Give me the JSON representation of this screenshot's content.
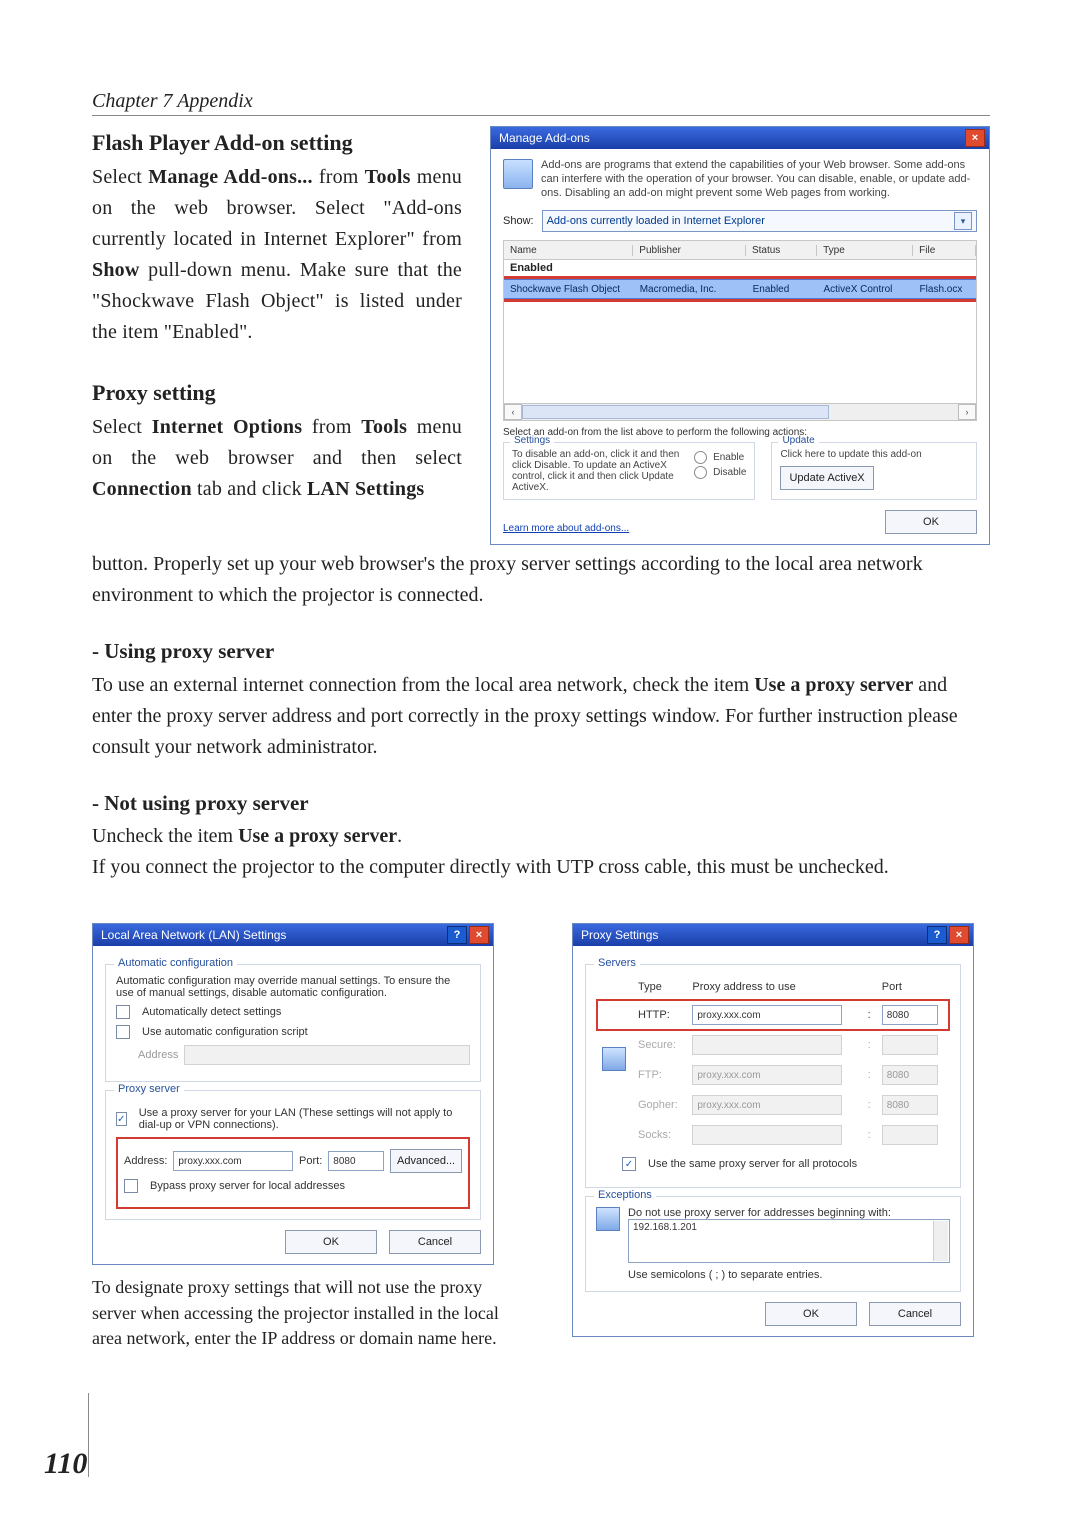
{
  "chapter": "Chapter 7 Appendix",
  "flash": {
    "heading": "Flash Player Add-on setting",
    "body_pre": "Select ",
    "b1": "Manage Add-ons...",
    "mid1": " from ",
    "b2": "Tools",
    "rest1": " menu on the web browser. Select \"Add-ons currently located in Internet Explorer\" from ",
    "b3": "Show",
    "rest2": " pull-down menu. Make sure that the \"Shockwave Flash Object\" is listed under the item \"Enabled\"."
  },
  "proxy": {
    "heading": "Proxy setting",
    "pre": "Select ",
    "b1": "Internet Options",
    "mid": " from ",
    "b2": "Tools",
    "rest1": " menu on the web browser and then select ",
    "b3": "Connection",
    "mid2": " tab and click ",
    "b4": "LAN Settings",
    "rest2": " button. Properly set up your web browser's the proxy server settings according to the local area network environment to which the projector is connected."
  },
  "using": {
    "heading": "- Using proxy server",
    "text_pre": "To use an external internet connection from the local area network, check the item ",
    "b1": "Use a proxy server",
    "text_post": " and enter the proxy server address and port correctly in the proxy settings window. For further instruction please consult your network administrator."
  },
  "notusing": {
    "heading": "- Not using proxy server",
    "line1_pre": "Uncheck the item ",
    "line1_b": "Use a proxy server",
    "line1_post": ".",
    "line2": "If you connect the projector to the computer directly with UTP cross cable, this must be unchecked."
  },
  "caption": "To designate proxy settings that will not use the proxy server when accessing the projector installed in the local area network, enter the IP address or domain name here.",
  "page_number": "110",
  "addons": {
    "title": "Manage Add-ons",
    "intro": "Add-ons are programs that extend the capabilities of your Web browser. Some add-ons can interfere with the operation of your browser. You can disable, enable, or update add-ons. Disabling an add-on might prevent some Web pages from working.",
    "show_label": "Show:",
    "show_value": "Add-ons currently loaded in Internet Explorer",
    "cols": {
      "name": "Name",
      "publisher": "Publisher",
      "status": "Status",
      "type": "Type",
      "file": "File"
    },
    "group_enabled": "Enabled",
    "row_sel": {
      "name": "Shockwave Flash Object",
      "publisher": "Macromedia, Inc.",
      "status": "Enabled",
      "type": "ActiveX Control",
      "file": "Flash.ocx"
    },
    "hint": "Select an add-on from the list above to perform the following actions:",
    "settings_lg": "Settings",
    "settings_text": "To disable an add-on, click it and then click Disable. To update an ActiveX control, click it and then click Update ActiveX.",
    "enable": "Enable",
    "disable": "Disable",
    "update_lg": "Update",
    "update_text": "Click here to update this add-on",
    "update_btn": "Update ActiveX",
    "learn": "Learn more about add-ons...",
    "ok": "OK"
  },
  "lan": {
    "title": "Local Area Network (LAN) Settings",
    "auto_lg": "Automatic configuration",
    "auto_text": "Automatic configuration may override manual settings. To ensure the use of manual settings, disable automatic configuration.",
    "auto_detect": "Automatically detect settings",
    "auto_script": "Use automatic configuration script",
    "address_label": "Address",
    "proxy_lg": "Proxy server",
    "use_proxy": "Use a proxy server for your LAN (These settings will not apply to dial-up or VPN connections).",
    "addr_label": "Address:",
    "addr_value": "proxy.xxx.com",
    "port_label": "Port:",
    "port_value": "8080",
    "advanced": "Advanced...",
    "bypass": "Bypass proxy server for local addresses",
    "ok": "OK",
    "cancel": "Cancel"
  },
  "ps": {
    "title": "Proxy Settings",
    "servers_lg": "Servers",
    "type": "Type",
    "addr": "Proxy address to use",
    "port": "Port",
    "http": "HTTP:",
    "http_addr": "proxy.xxx.com",
    "http_port": "8080",
    "secure": "Secure:",
    "ftp": "FTP:",
    "ftp_addr": "proxy.xxx.com",
    "ftp_port": "8080",
    "gopher": "Gopher:",
    "gopher_addr": "proxy.xxx.com",
    "gopher_port": "8080",
    "socks": "Socks:",
    "same": "Use the same proxy server for all protocols",
    "exc_lg": "Exceptions",
    "exc_text": "Do not use proxy server for addresses beginning with:",
    "exc_value": "192.168.1.201",
    "exc_note": "Use semicolons ( ; ) to separate entries.",
    "ok": "OK",
    "cancel": "Cancel"
  }
}
